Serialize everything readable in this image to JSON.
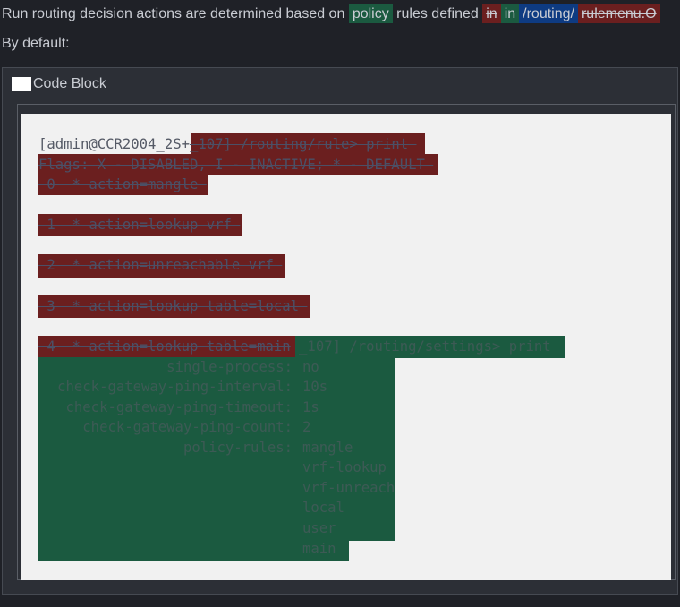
{
  "intro": {
    "before": "Run routing decision actions are determined based on",
    "policy": "policy",
    "mid": "rules defined",
    "del_in": "in",
    "ins_in": "in",
    "path": "/routing/",
    "del_tail": "rulemenu.O"
  },
  "by_default": "By default:",
  "code_block": {
    "title": "Code Block",
    "prompt": "[admin@CCR2004_2S+",
    "del_rule_cmd": "_107] /routing/rule> print ",
    "flags": "Flags: X - DISABLED, I - INACTIVE; * - DEFAULT ",
    "rules": [
      " 0  * action=mangle ",
      " 1  * action=lookup vrf ",
      " 2  * action=unreachable vrf ",
      " 3  * action=lookup table=local ",
      " 4  * action=lookup table=main"
    ],
    "settings_cmd": " _107] /routing/settings> print ",
    "settings": [
      {
        "key": "               single-process:",
        "value": "no"
      },
      {
        "key": " check-gateway-ping-interval:",
        "value": "10s"
      },
      {
        "key": "  check-gateway-ping-timeout:",
        "value": "1s"
      },
      {
        "key": "    check-gateway-ping-count:",
        "value": "2"
      },
      {
        "key": "                policy-rules:",
        "value": "mangle"
      }
    ],
    "policy_rules_more": [
      "vrf-lookup",
      "vrf-unreach",
      "local",
      "user",
      "main"
    ]
  },
  "colors": {
    "deleted": "#6b1f1f",
    "inserted": "#1b5a40",
    "path": "#0e3b82"
  }
}
